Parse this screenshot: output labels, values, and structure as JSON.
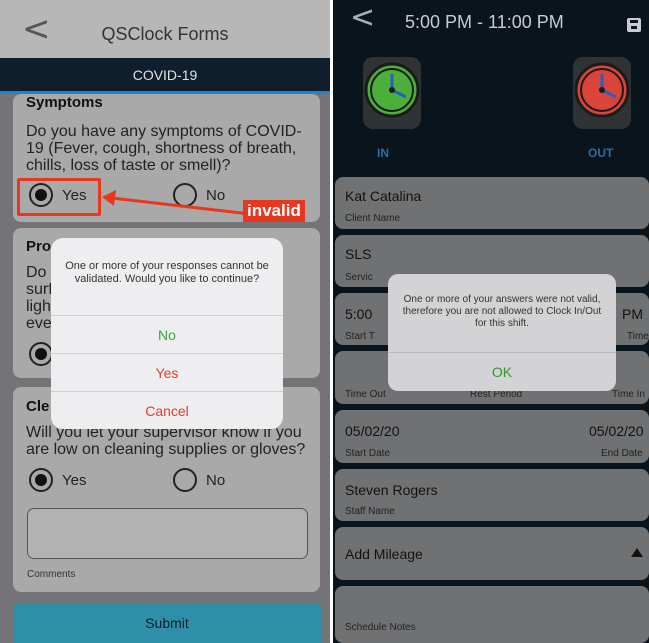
{
  "left": {
    "header": {
      "back_glyph": "<",
      "title": "QSClock Forms"
    },
    "tab": "COVID-19",
    "symptoms": {
      "title": "Symptoms",
      "question": "Do you have any symptoms of COVID-19 (Fever, cough, shortness of breath, chills, loss of taste or smell)?",
      "yes": "Yes",
      "no": "No",
      "selected": "Yes"
    },
    "invalid_label": "invalid",
    "hidden_cards": {
      "card2_title": "Pro",
      "card2_lines": [
        "Do",
        "surf",
        "ligh",
        "eve"
      ],
      "card3_title": "Cle"
    },
    "cleaning": {
      "question": "Will you let your supervisor know if you are low on cleaning supplies or gloves?",
      "yes": "Yes",
      "no": "No",
      "selected": "Yes"
    },
    "comments_label": "Comments",
    "submit_label": "Submit",
    "dialog": {
      "message": "One or more of your responses cannot be validated. Would you like to continue?",
      "buttons": [
        {
          "label": "No",
          "color": "#3aa53a"
        },
        {
          "label": "Yes",
          "color": "#e23b2a"
        },
        {
          "label": "Cancel",
          "color": "#e23b2a"
        }
      ]
    }
  },
  "right": {
    "header": {
      "back_glyph": "<",
      "title": "5:00 PM - 11:00 PM",
      "save_icon": "save-icon"
    },
    "clock_in_label": "IN",
    "clock_out_label": "OUT",
    "client": {
      "value": "Kat Catalina",
      "label": "Client Name"
    },
    "service": {
      "value": "SLS",
      "label": "Servic"
    },
    "times": {
      "start_value": "5:00",
      "start_label": "Start T",
      "end_value": "PM",
      "end_label": "Time"
    },
    "time_row": {
      "time_out": "Time Out",
      "rest_period": "Rest Period",
      "time_in": "Time In"
    },
    "dates": {
      "start_value": "05/02/20",
      "start_label": "Start Date",
      "end_value": "05/02/20",
      "end_label": "End Date"
    },
    "staff": {
      "value": "Steven Rogers",
      "label": "Staff Name"
    },
    "mileage": {
      "value": "Add Mileage"
    },
    "notes": {
      "label": "Schedule Notes"
    },
    "dialog": {
      "message": "One or more of your answers were not valid, therefore you are not allowed to Clock In/Out for this shift.",
      "ok": "OK"
    }
  },
  "colors": {
    "accent_blue": "#1d82d6",
    "invalid_red": "#e8371c",
    "ok_green": "#2c9a2c",
    "clock_in_green": "#4caf3a",
    "clock_out_red": "#d9453a"
  }
}
